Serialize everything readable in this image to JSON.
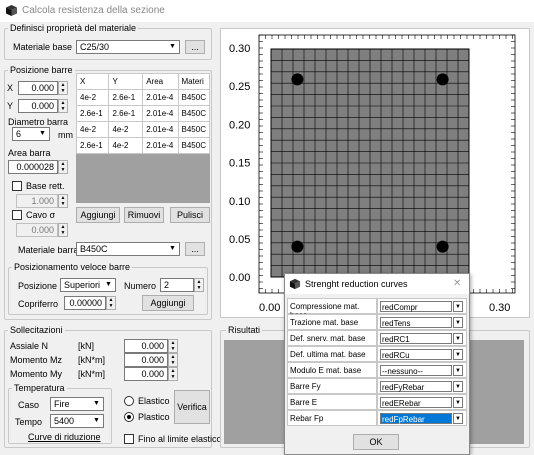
{
  "window": {
    "title": "Calcola resistenza della sezione"
  },
  "material": {
    "group_label": "Definisci proprietà del materiale",
    "base_label": "Materiale base",
    "base_value": "C25/30",
    "browse_label": "..."
  },
  "bars": {
    "group_label": "Posizione barre",
    "x_label": "X",
    "x_value": "0.000",
    "y_label": "Y",
    "y_value": "0.000",
    "diam_label": "Diametro barra",
    "diam_value": "6",
    "mm_label": "mm",
    "area_label": "Area barra",
    "area_value": "0.000028",
    "base_rett_label": "Base rett.",
    "base_rett_value": "1.000",
    "cavo_label": "Cavo σ",
    "cavo_value": "0.000",
    "table": {
      "headers": [
        "X",
        "Y",
        "Area",
        "Materi"
      ],
      "rows": [
        [
          "4e-2",
          "2.6e-1",
          "2.01e-4",
          "B450C"
        ],
        [
          "2.6e-1",
          "2.6e-1",
          "2.01e-4",
          "B450C"
        ],
        [
          "4e-2",
          "4e-2",
          "2.01e-4",
          "B450C"
        ],
        [
          "2.6e-1",
          "4e-2",
          "2.01e-4",
          "B450C"
        ]
      ]
    },
    "add_label": "Aggiungi",
    "remove_label": "Rimuovi",
    "clear_label": "Pulisci",
    "material_label": "Materiale barra",
    "material_value": "B450C",
    "browse_label": "..."
  },
  "quick": {
    "group_label": "Posizionamento veloce barre",
    "pos_label": "Posizione",
    "pos_value": "Superiori",
    "num_label": "Numero",
    "num_value": "2",
    "cover_label": "Copriferro",
    "cover_value": "0.00000",
    "add_label": "Aggiungi"
  },
  "plot": {
    "y_ticks": [
      "0.30",
      "0.25",
      "0.20",
      "0.15",
      "0.10",
      "0.05",
      "0.00"
    ],
    "x_ticks": [
      "0.00",
      "0.30"
    ],
    "section_color": "#7f7f7f",
    "bars_xy": [
      [
        0.04,
        0.26
      ],
      [
        0.26,
        0.26
      ],
      [
        0.04,
        0.04
      ],
      [
        0.26,
        0.04
      ]
    ]
  },
  "loads": {
    "group_label": "Sollecitazioni",
    "rows": [
      {
        "label": "Assiale N",
        "unit": "[kN]",
        "value": "0.000"
      },
      {
        "label": "Momento Mz",
        "unit": "[kN*m]",
        "value": "0.000"
      },
      {
        "label": "Momento My",
        "unit": "[kN*m]",
        "value": "0.000"
      }
    ]
  },
  "temperature": {
    "group_label": "Temperatura",
    "case_label": "Caso",
    "case_value": "Fire",
    "time_label": "Tempo",
    "time_value": "5400",
    "curves_label": "Curve di riduzione",
    "elastic_label": "Elastico",
    "plastic_label": "Plastico",
    "verify_label": "Verifica",
    "limit_label": "Fino al limite elastico"
  },
  "results": {
    "group_label": "Risultati"
  },
  "dialog": {
    "title": "Strenght reduction curves",
    "close_label": "✕",
    "rows": [
      {
        "label": "Compressione mat. base",
        "value": "redCompr"
      },
      {
        "label": "Trazione mat. base",
        "value": "redTens"
      },
      {
        "label": "Def. snerv. mat. base",
        "value": "redRC1"
      },
      {
        "label": "Def. ultima mat. base",
        "value": "redRCu"
      },
      {
        "label": "Modulo E mat. base",
        "value": "--nessuno--"
      },
      {
        "label": "Barre Fy",
        "value": "redFyRebar"
      },
      {
        "label": "Barre E",
        "value": "redERebar"
      },
      {
        "label": "Rebar Fp",
        "value": "redFpRebar"
      }
    ],
    "ok_label": "OK"
  }
}
